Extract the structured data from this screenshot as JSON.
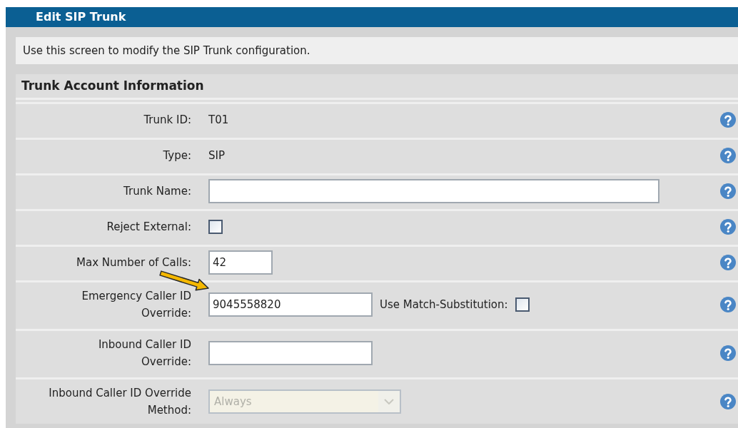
{
  "title": "Edit SIP Trunk",
  "description": "Use this screen to modify the SIP Trunk configuration.",
  "section": {
    "title": "Trunk Account Information",
    "rows": [
      {
        "kind": "text",
        "label": "Trunk ID:",
        "value": "T01"
      },
      {
        "kind": "text",
        "label": "Type:",
        "value": "SIP"
      },
      {
        "kind": "input",
        "label": "Trunk Name:"
      },
      {
        "kind": "checkbox",
        "label": "Reject External:",
        "checked": false
      },
      {
        "kind": "input",
        "label": "Max Number of Calls:",
        "value": "42"
      },
      {
        "kind": "input",
        "label": "Emergency Caller ID Override:",
        "value": "9045558820",
        "extra": {
          "label": "Use Match-Substitution:",
          "checked": false
        }
      },
      {
        "kind": "input",
        "label": "Inbound Caller ID Override:"
      },
      {
        "kind": "select",
        "label": "Inbound Caller ID Override Method:",
        "value": "Always",
        "disabled": true
      }
    ]
  }
}
